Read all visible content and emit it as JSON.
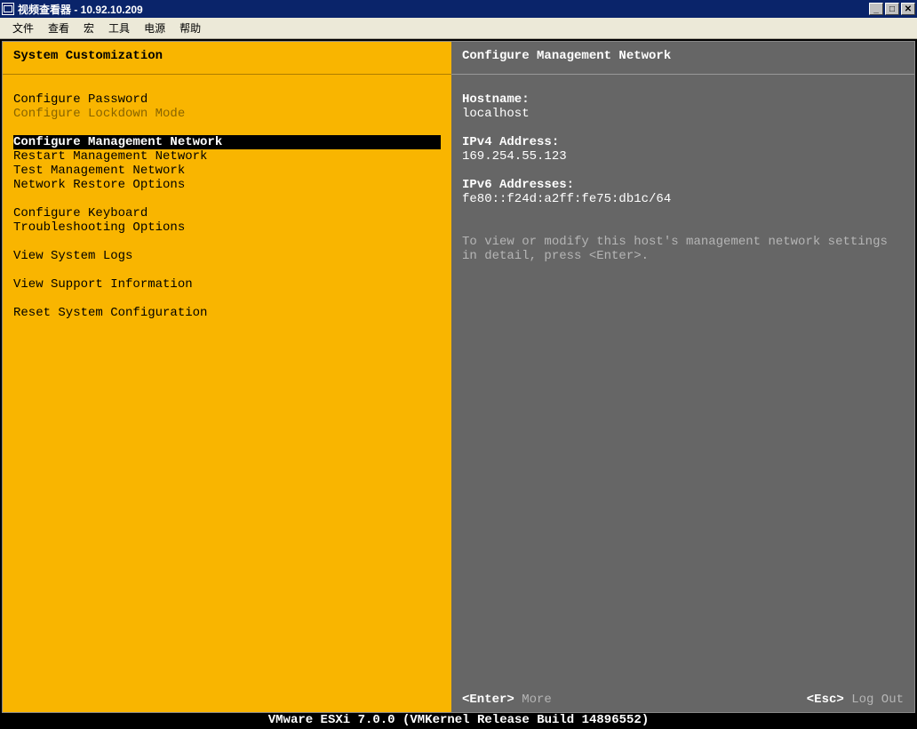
{
  "window": {
    "title": "视频查看器 - 10.92.10.209"
  },
  "menubar": {
    "items": [
      "文件",
      "查看",
      "宏",
      "工具",
      "电源",
      "帮助"
    ]
  },
  "left_panel": {
    "title": "System Customization",
    "items": [
      {
        "label": "Configure Password",
        "type": "normal"
      },
      {
        "label": "Configure Lockdown Mode",
        "type": "disabled"
      },
      {
        "type": "spacer"
      },
      {
        "label": "Configure Management Network",
        "type": "selected"
      },
      {
        "label": "Restart Management Network",
        "type": "normal"
      },
      {
        "label": "Test Management Network",
        "type": "normal"
      },
      {
        "label": "Network Restore Options",
        "type": "normal"
      },
      {
        "type": "spacer"
      },
      {
        "label": "Configure Keyboard",
        "type": "normal"
      },
      {
        "label": "Troubleshooting Options",
        "type": "normal"
      },
      {
        "type": "spacer"
      },
      {
        "label": "View System Logs",
        "type": "normal"
      },
      {
        "type": "spacer"
      },
      {
        "label": "View Support Information",
        "type": "normal"
      },
      {
        "type": "spacer"
      },
      {
        "label": "Reset System Configuration",
        "type": "normal"
      }
    ]
  },
  "right_panel": {
    "title": "Configure Management Network",
    "hostname_label": "Hostname:",
    "hostname_value": "localhost",
    "ipv4_label": "IPv4 Address:",
    "ipv4_value": "169.254.55.123",
    "ipv6_label": "IPv6 Addresses:",
    "ipv6_value": "fe80::f24d:a2ff:fe75:db1c/64",
    "hint": "To view or modify this host's management network settings in detail, press <Enter>."
  },
  "footer": {
    "enter_key": "<Enter>",
    "enter_action": "More",
    "esc_key": "<Esc>",
    "esc_action": "Log Out"
  },
  "status_bar": "VMware ESXi 7.0.0 (VMKernel Release Build 14896552)"
}
